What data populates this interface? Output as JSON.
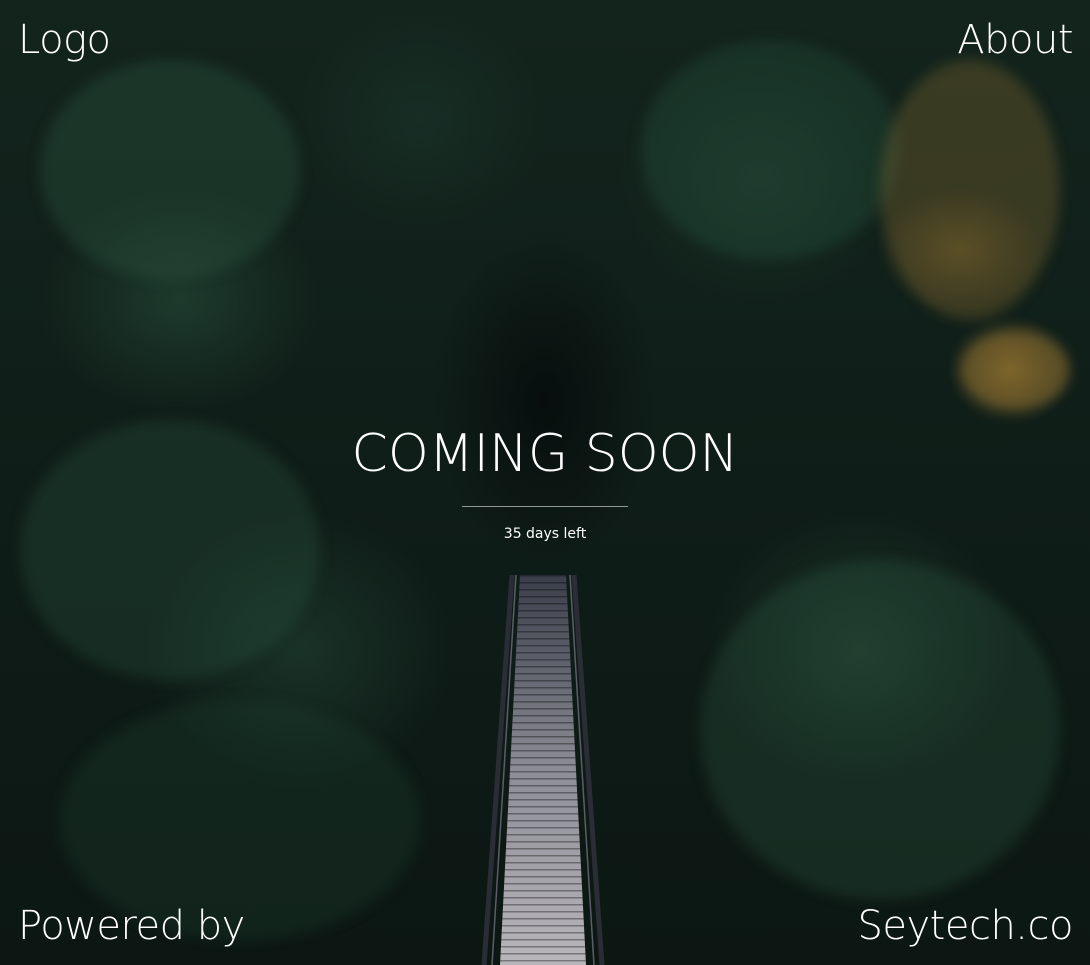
{
  "header": {
    "logo_label": "Logo",
    "about_label": "About"
  },
  "hero": {
    "headline": "COMING SOON",
    "countdown_text": "35 days left"
  },
  "footer": {
    "powered_by_label": "Powered by",
    "brand_label": "Seytech.co"
  },
  "colors": {
    "text": "#ffffff",
    "background_forest": "#13241d",
    "autumn_accent": "#b8883a"
  }
}
